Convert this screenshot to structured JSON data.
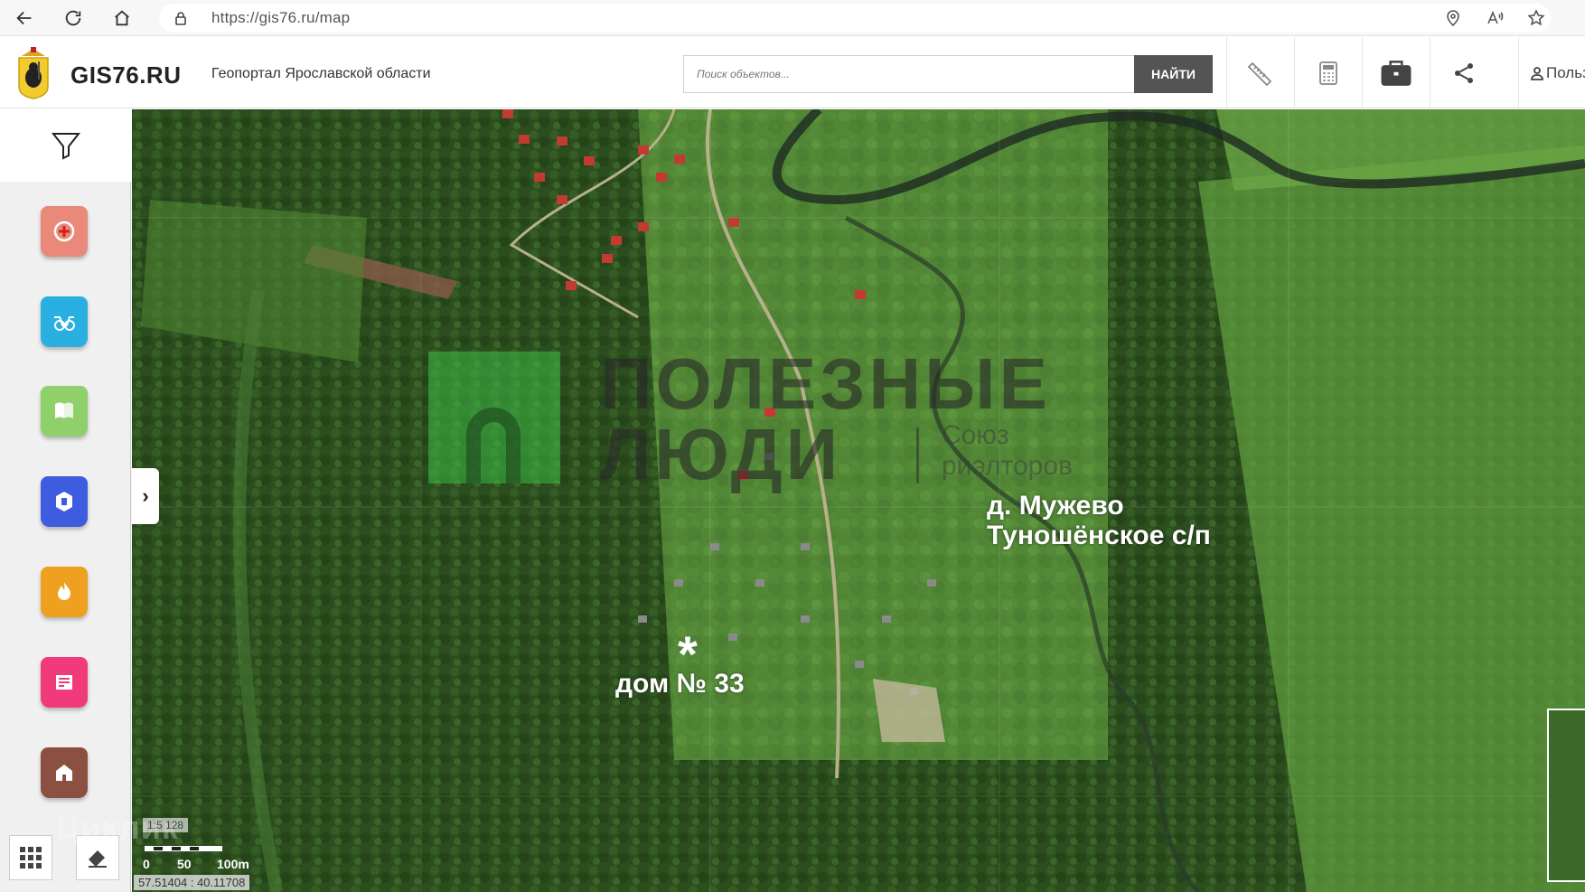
{
  "browser": {
    "url": "https://gis76.ru/map"
  },
  "header": {
    "brand": "GIS76.RU",
    "subtitle": "Геопортал Ярославской области",
    "search_placeholder": "Поиск объектов...",
    "search_button": "НАЙТИ",
    "user_label": "Польз"
  },
  "sidebar": {
    "categories": [
      {
        "name": "healthcare",
        "color": "#e8897a"
      },
      {
        "name": "social",
        "color": "#2ab0e0"
      },
      {
        "name": "education",
        "color": "#8fd06a"
      },
      {
        "name": "culture",
        "color": "#3e5ce0"
      },
      {
        "name": "sport",
        "color": "#f0a020"
      },
      {
        "name": "commerce",
        "color": "#f03a7a"
      },
      {
        "name": "housing",
        "color": "#8c5040"
      }
    ]
  },
  "map": {
    "expand_arrow": "›",
    "watermark": {
      "line1": "ПОЛЕЗНЫЕ",
      "line2": "ЛЮДИ",
      "sub1": "Союз",
      "sub2": "риэлторов"
    },
    "village_line1": "д. Мужево",
    "village_line2": "Туношёнское с/п",
    "house_marker": "*",
    "house_label": "дом № 33",
    "scale_ratio": "1:5 128",
    "scale_ticks": [
      "0",
      "50",
      "100m"
    ],
    "coordinates": "57.51404 : 40.11708",
    "overlay_watermark": "Циклик"
  }
}
